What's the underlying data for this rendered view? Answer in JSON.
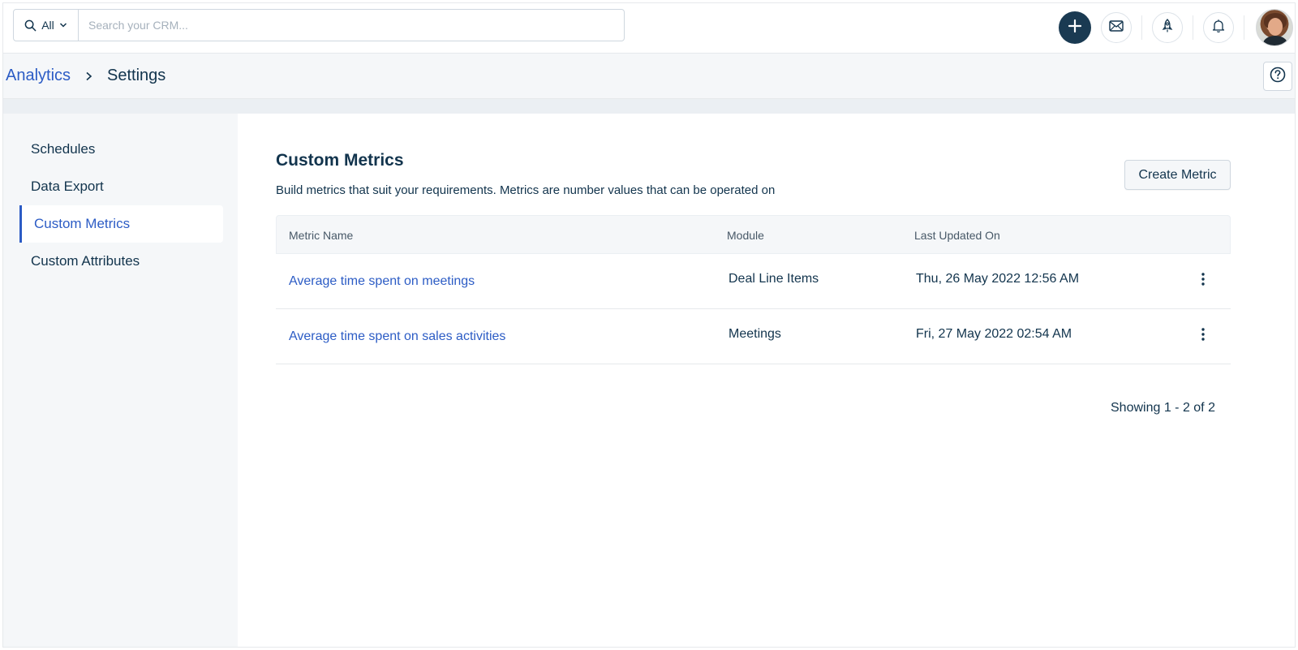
{
  "search": {
    "scope_label": "All",
    "placeholder": "Search your CRM..."
  },
  "top_icons": [
    "plus-icon",
    "mail-icon",
    "rocket-icon",
    "bell-icon",
    "avatar"
  ],
  "breadcrumb": {
    "parent": "Analytics",
    "current": "Settings"
  },
  "sidebar": {
    "items": [
      {
        "label": "Schedules",
        "active": false
      },
      {
        "label": "Data Export",
        "active": false
      },
      {
        "label": "Custom Metrics",
        "active": true
      },
      {
        "label": "Custom Attributes",
        "active": false
      }
    ]
  },
  "main": {
    "title": "Custom Metrics",
    "subtitle": "Build metrics that suit your requirements. Metrics are number values that can be operated on",
    "create_button": "Create Metric",
    "table": {
      "columns": [
        "Metric Name",
        "Module",
        "Last Updated On"
      ],
      "rows": [
        {
          "name": "Average time spent on meetings",
          "module": "Deal Line Items",
          "updated": "Thu, 26 May 2022 12:56 AM"
        },
        {
          "name": "Average time spent on sales activities",
          "module": "Meetings",
          "updated": "Fri, 27 May 2022 02:54 AM"
        }
      ]
    },
    "pagination": "Showing 1 - 2 of 2"
  },
  "colors": {
    "accent": "#2c5cc5",
    "text": "#12344d",
    "add_button": "#1a3a52",
    "panel_bg": "#f5f7f9"
  }
}
